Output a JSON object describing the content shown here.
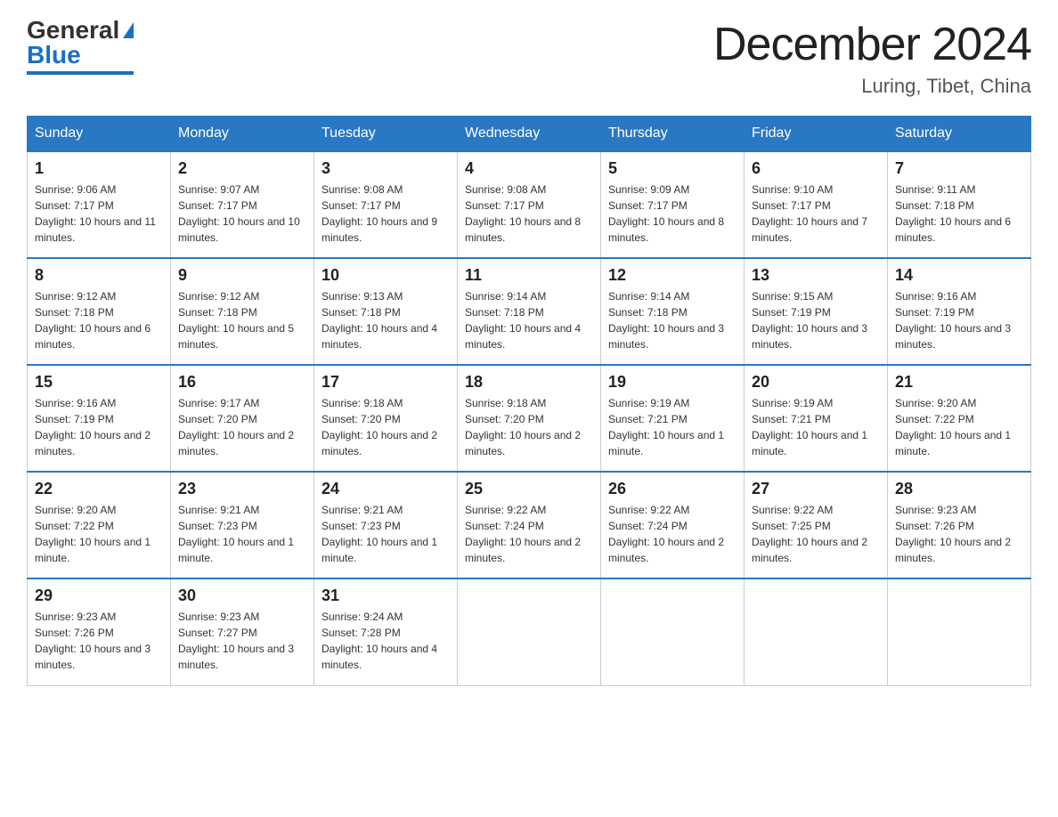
{
  "header": {
    "logo_general": "General",
    "logo_blue": "Blue",
    "title": "December 2024",
    "subtitle": "Luring, Tibet, China"
  },
  "days_of_week": [
    "Sunday",
    "Monday",
    "Tuesday",
    "Wednesday",
    "Thursday",
    "Friday",
    "Saturday"
  ],
  "weeks": [
    [
      {
        "day": "1",
        "sunrise": "9:06 AM",
        "sunset": "7:17 PM",
        "daylight": "10 hours and 11 minutes."
      },
      {
        "day": "2",
        "sunrise": "9:07 AM",
        "sunset": "7:17 PM",
        "daylight": "10 hours and 10 minutes."
      },
      {
        "day": "3",
        "sunrise": "9:08 AM",
        "sunset": "7:17 PM",
        "daylight": "10 hours and 9 minutes."
      },
      {
        "day": "4",
        "sunrise": "9:08 AM",
        "sunset": "7:17 PM",
        "daylight": "10 hours and 8 minutes."
      },
      {
        "day": "5",
        "sunrise": "9:09 AM",
        "sunset": "7:17 PM",
        "daylight": "10 hours and 8 minutes."
      },
      {
        "day": "6",
        "sunrise": "9:10 AM",
        "sunset": "7:17 PM",
        "daylight": "10 hours and 7 minutes."
      },
      {
        "day": "7",
        "sunrise": "9:11 AM",
        "sunset": "7:18 PM",
        "daylight": "10 hours and 6 minutes."
      }
    ],
    [
      {
        "day": "8",
        "sunrise": "9:12 AM",
        "sunset": "7:18 PM",
        "daylight": "10 hours and 6 minutes."
      },
      {
        "day": "9",
        "sunrise": "9:12 AM",
        "sunset": "7:18 PM",
        "daylight": "10 hours and 5 minutes."
      },
      {
        "day": "10",
        "sunrise": "9:13 AM",
        "sunset": "7:18 PM",
        "daylight": "10 hours and 4 minutes."
      },
      {
        "day": "11",
        "sunrise": "9:14 AM",
        "sunset": "7:18 PM",
        "daylight": "10 hours and 4 minutes."
      },
      {
        "day": "12",
        "sunrise": "9:14 AM",
        "sunset": "7:18 PM",
        "daylight": "10 hours and 3 minutes."
      },
      {
        "day": "13",
        "sunrise": "9:15 AM",
        "sunset": "7:19 PM",
        "daylight": "10 hours and 3 minutes."
      },
      {
        "day": "14",
        "sunrise": "9:16 AM",
        "sunset": "7:19 PM",
        "daylight": "10 hours and 3 minutes."
      }
    ],
    [
      {
        "day": "15",
        "sunrise": "9:16 AM",
        "sunset": "7:19 PM",
        "daylight": "10 hours and 2 minutes."
      },
      {
        "day": "16",
        "sunrise": "9:17 AM",
        "sunset": "7:20 PM",
        "daylight": "10 hours and 2 minutes."
      },
      {
        "day": "17",
        "sunrise": "9:18 AM",
        "sunset": "7:20 PM",
        "daylight": "10 hours and 2 minutes."
      },
      {
        "day": "18",
        "sunrise": "9:18 AM",
        "sunset": "7:20 PM",
        "daylight": "10 hours and 2 minutes."
      },
      {
        "day": "19",
        "sunrise": "9:19 AM",
        "sunset": "7:21 PM",
        "daylight": "10 hours and 1 minute."
      },
      {
        "day": "20",
        "sunrise": "9:19 AM",
        "sunset": "7:21 PM",
        "daylight": "10 hours and 1 minute."
      },
      {
        "day": "21",
        "sunrise": "9:20 AM",
        "sunset": "7:22 PM",
        "daylight": "10 hours and 1 minute."
      }
    ],
    [
      {
        "day": "22",
        "sunrise": "9:20 AM",
        "sunset": "7:22 PM",
        "daylight": "10 hours and 1 minute."
      },
      {
        "day": "23",
        "sunrise": "9:21 AM",
        "sunset": "7:23 PM",
        "daylight": "10 hours and 1 minute."
      },
      {
        "day": "24",
        "sunrise": "9:21 AM",
        "sunset": "7:23 PM",
        "daylight": "10 hours and 1 minute."
      },
      {
        "day": "25",
        "sunrise": "9:22 AM",
        "sunset": "7:24 PM",
        "daylight": "10 hours and 2 minutes."
      },
      {
        "day": "26",
        "sunrise": "9:22 AM",
        "sunset": "7:24 PM",
        "daylight": "10 hours and 2 minutes."
      },
      {
        "day": "27",
        "sunrise": "9:22 AM",
        "sunset": "7:25 PM",
        "daylight": "10 hours and 2 minutes."
      },
      {
        "day": "28",
        "sunrise": "9:23 AM",
        "sunset": "7:26 PM",
        "daylight": "10 hours and 2 minutes."
      }
    ],
    [
      {
        "day": "29",
        "sunrise": "9:23 AM",
        "sunset": "7:26 PM",
        "daylight": "10 hours and 3 minutes."
      },
      {
        "day": "30",
        "sunrise": "9:23 AM",
        "sunset": "7:27 PM",
        "daylight": "10 hours and 3 minutes."
      },
      {
        "day": "31",
        "sunrise": "9:24 AM",
        "sunset": "7:28 PM",
        "daylight": "10 hours and 4 minutes."
      },
      null,
      null,
      null,
      null
    ]
  ]
}
